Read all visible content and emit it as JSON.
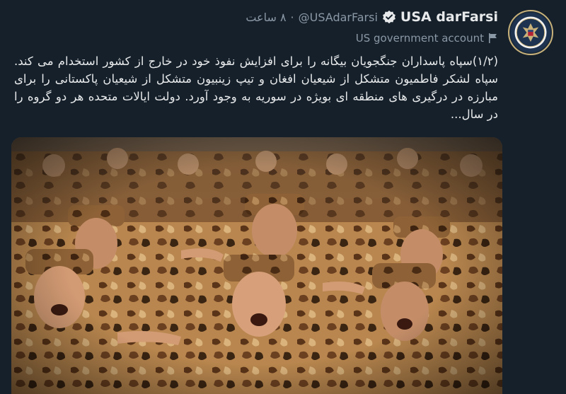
{
  "tweet": {
    "display_name": "USA darFarsi",
    "handle": "@USAdarFarsi",
    "separator": "·",
    "time": "۸ ساعت",
    "label": "US government account",
    "text": "(۱/۲)سپاه پاسداران جنگجویان بیگانه را برای افزایش نفوذ خود در خارج از کشور استخدام می کند. سپاه لشکر فاطمیون متشکل از شیعیان افغان و تیپ زینبیون متشکل از شیعیان پاکستانی را برای مبارزه در درگیری های منطقه ای بویژه در سوریه به وجود آورد. دولت ایالات متحده هر دو گروه را در سال..."
  },
  "colors": {
    "background": "#15202b",
    "text": "#e7e9ea",
    "muted": "#8b98a5",
    "verified": "#e7e9ea"
  },
  "icons": {
    "verified": "verified-badge-icon",
    "label": "government-flag-icon",
    "avatar": "us-state-department-seal"
  },
  "media": {
    "description_type": "photo"
  }
}
